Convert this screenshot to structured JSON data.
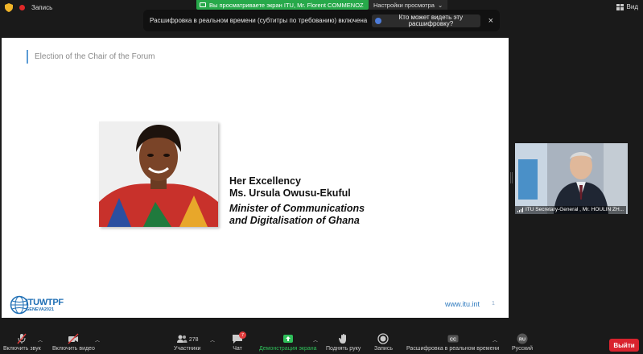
{
  "topbar": {
    "record_label": "Запись",
    "share_notice": "Вы просматриваете экран ITU, Mr. Florent COMMENOZ",
    "view_options": "Настройки просмотра",
    "view_label": "Вид"
  },
  "banner": {
    "message": "Расшифровка в реальном времени (субтитры по требованию) включена",
    "who_button": "Кто может видеть эту расшифровку?",
    "close": "×"
  },
  "slide": {
    "title": "Election of the Chair of the Forum",
    "name_line1": "Her Excellency",
    "name_line2": "Ms. Ursula Owusu-Ekuful",
    "role_line1": "Minister of Communications",
    "role_line2": "and Digitalisation of Ghana",
    "logo_main": "ITUWTPF",
    "logo_sub": "GENEVA2021",
    "url": "www.itu.int",
    "page": "1"
  },
  "video": {
    "participant_name": "ITU Secretary-General , Mr. HOULIN ZH..."
  },
  "toolbar": {
    "unmute": "Включить звук",
    "start_video": "Включить видео",
    "participants": "Участники",
    "participants_count": "278",
    "chat": "Чат",
    "chat_badge": "7",
    "share_screen": "Демонстрация экрана",
    "raise_hand": "Поднять руку",
    "record": "Запись",
    "live_transcript": "Расшифровка в реальном времени",
    "language": "Русский",
    "language_code": "RU",
    "leave": "Выйти"
  },
  "colors": {
    "share_green": "#27a94a",
    "leave_red": "#d9232e",
    "itu_blue": "#1f6fb5"
  }
}
